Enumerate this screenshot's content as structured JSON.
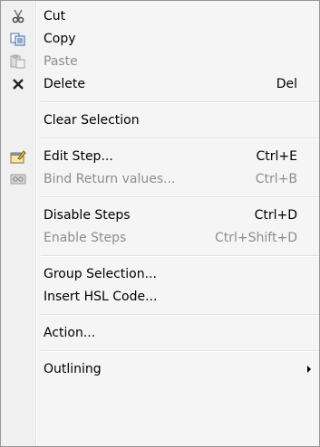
{
  "menu": {
    "items": [
      {
        "label": "Cut",
        "icon": "scissors-icon",
        "enabled": true,
        "shortcut": "",
        "sep_after": false
      },
      {
        "label": "Copy",
        "icon": "copy-icon",
        "enabled": true,
        "shortcut": "",
        "sep_after": false
      },
      {
        "label": "Paste",
        "icon": "paste-icon",
        "enabled": false,
        "shortcut": "",
        "sep_after": false
      },
      {
        "label": "Delete",
        "icon": "delete-x-icon",
        "enabled": true,
        "shortcut": "Del",
        "sep_after": true
      },
      {
        "label": "Clear Selection",
        "icon": "",
        "enabled": true,
        "shortcut": "",
        "sep_after": true
      },
      {
        "label": "Edit Step...",
        "icon": "edit-step-icon",
        "enabled": true,
        "shortcut": "Ctrl+E",
        "sep_after": false
      },
      {
        "label": "Bind Return values...",
        "icon": "bind-icon",
        "enabled": false,
        "shortcut": "Ctrl+B",
        "sep_after": true
      },
      {
        "label": "Disable Steps",
        "icon": "",
        "enabled": true,
        "shortcut": "Ctrl+D",
        "sep_after": false
      },
      {
        "label": "Enable Steps",
        "icon": "",
        "enabled": false,
        "shortcut": "Ctrl+Shift+D",
        "sep_after": true
      },
      {
        "label": "Group Selection...",
        "icon": "",
        "enabled": true,
        "shortcut": "",
        "sep_after": false
      },
      {
        "label": "Insert HSL Code...",
        "icon": "",
        "enabled": true,
        "shortcut": "",
        "sep_after": true
      },
      {
        "label": "Action...",
        "icon": "",
        "enabled": true,
        "shortcut": "",
        "sep_after": true
      },
      {
        "label": "Outlining",
        "icon": "",
        "enabled": true,
        "shortcut": "",
        "submenu": true,
        "sep_after": false
      }
    ]
  }
}
